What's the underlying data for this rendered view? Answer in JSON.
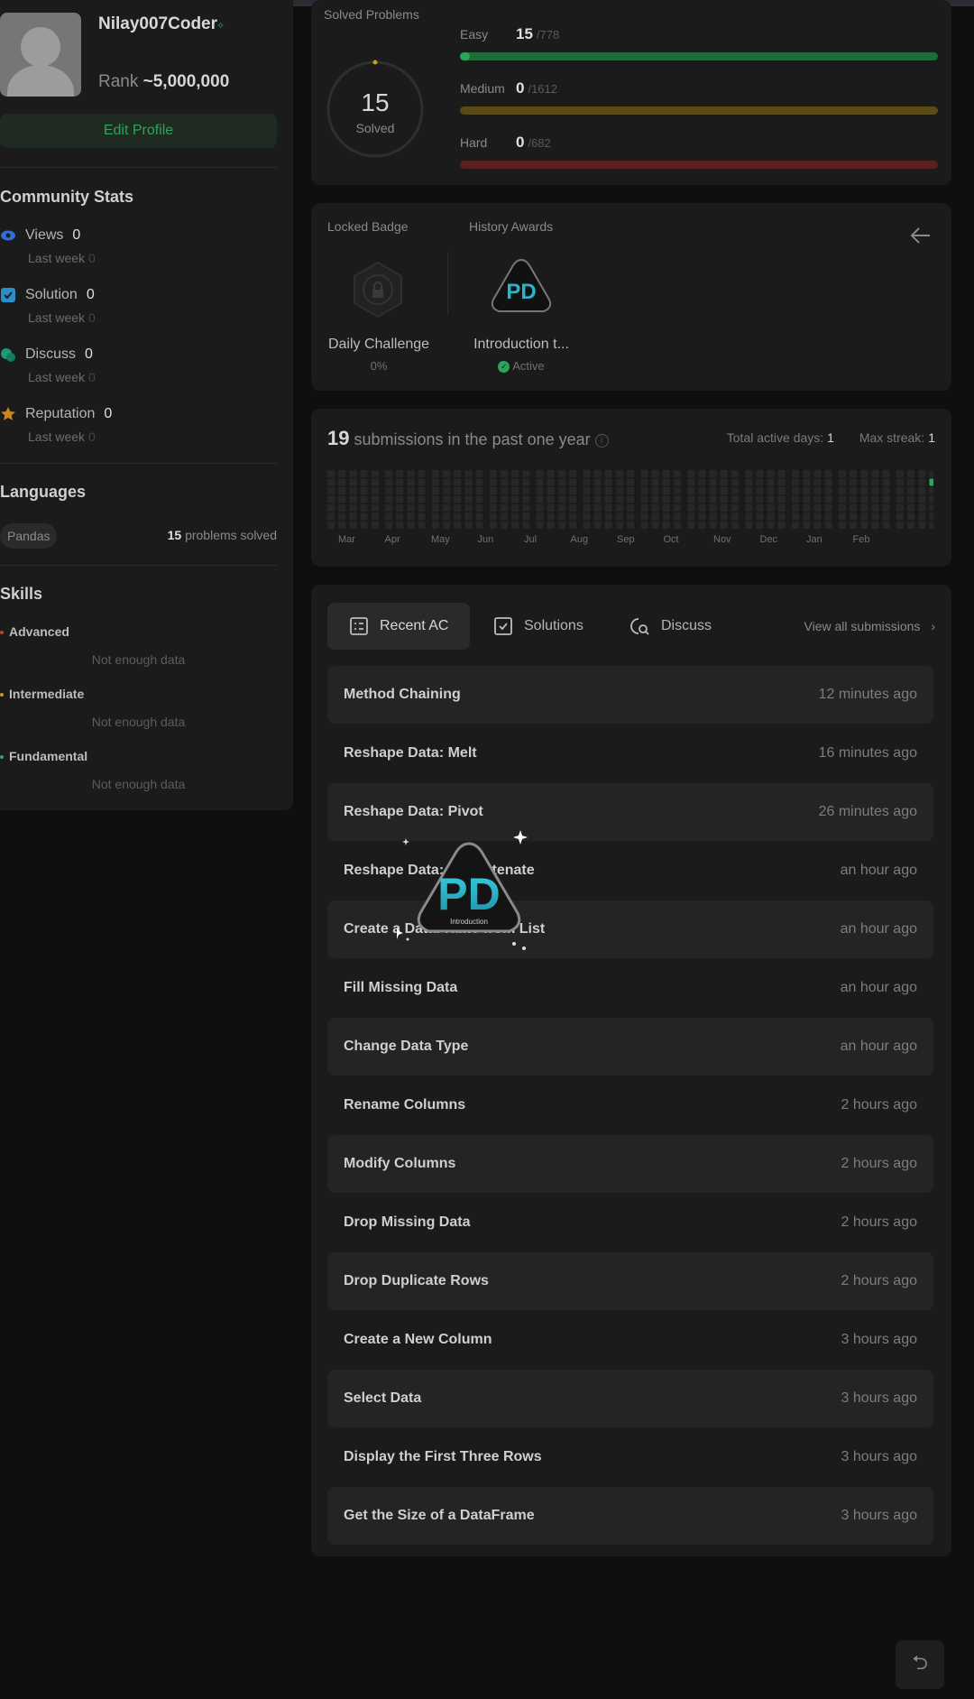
{
  "profile": {
    "username": "Nilay007Coder",
    "rank_label": "Rank",
    "rank_value": "~5,000,000",
    "edit_button": "Edit Profile"
  },
  "community": {
    "title": "Community Stats",
    "last_week_label": "Last week",
    "items": [
      {
        "label": "Views",
        "value": "0",
        "last_week": "0",
        "icon": "eye-icon",
        "color": "#2f6fd6"
      },
      {
        "label": "Solution",
        "value": "0",
        "last_week": "0",
        "icon": "solution-check-icon",
        "color": "#2a8fc8"
      },
      {
        "label": "Discuss",
        "value": "0",
        "last_week": "0",
        "icon": "discuss-icon",
        "color": "#1f9a74"
      },
      {
        "label": "Reputation",
        "value": "0",
        "last_week": "0",
        "icon": "star-icon",
        "color": "#c8861e"
      }
    ]
  },
  "languages": {
    "title": "Languages",
    "tag": "Pandas",
    "solved_count": "15",
    "solved_suffix": "problems solved"
  },
  "skills": {
    "title": "Skills",
    "items": [
      {
        "label": "Advanced",
        "color": "#b8432f",
        "empty": "Not enough data"
      },
      {
        "label": "Intermediate",
        "color": "#c89a1e",
        "empty": "Not enough data"
      },
      {
        "label": "Fundamental",
        "color": "#2ca55a",
        "empty": "Not enough data"
      }
    ]
  },
  "solved": {
    "title": "Solved Problems",
    "total": "15",
    "total_label": "Solved",
    "difficulties": [
      {
        "label": "Easy",
        "solved": "15",
        "total": "/778",
        "fraction": 0.019,
        "color": "#1f6b3a",
        "fill": "#2ca55a"
      },
      {
        "label": "Medium",
        "solved": "0",
        "total": "/1612",
        "fraction": 0,
        "color": "#5a4b16",
        "fill": "#c89a1e"
      },
      {
        "label": "Hard",
        "solved": "0",
        "total": "/682",
        "fraction": 0,
        "color": "#5a1f1f",
        "fill": "#c8433a"
      }
    ]
  },
  "badges": {
    "locked_label": "Locked Badge",
    "history_label": "History Awards",
    "locked_name": "Daily Challenge",
    "locked_progress": "0%",
    "award_name": "Introduction t...",
    "award_status": "Active",
    "badge_text": "PD",
    "badge_subtext": "Introduction"
  },
  "submissions": {
    "count": "19",
    "count_text": "submissions in the past one year",
    "active_days_label": "Total active days:",
    "active_days": "1",
    "max_streak_label": "Max streak:",
    "max_streak": "1",
    "months": [
      "Mar",
      "Apr",
      "May",
      "Jun",
      "Jul",
      "Aug",
      "Sep",
      "Oct",
      "Nov",
      "Dec",
      "Jan",
      "Feb"
    ]
  },
  "recent": {
    "tabs": [
      {
        "label": "Recent AC",
        "icon": "recent-ac-icon"
      },
      {
        "label": "Solutions",
        "icon": "solutions-icon"
      },
      {
        "label": "Discuss",
        "icon": "discuss-search-icon"
      }
    ],
    "view_all": "View all submissions",
    "items": [
      {
        "title": "Method Chaining",
        "time": "12 minutes ago"
      },
      {
        "title": "Reshape Data: Melt",
        "time": "16 minutes ago"
      },
      {
        "title": "Reshape Data: Pivot",
        "time": "26 minutes ago"
      },
      {
        "title": "Reshape Data: Concatenate",
        "time": "an hour ago"
      },
      {
        "title": "Create a DataFrame from List",
        "time": "an hour ago"
      },
      {
        "title": "Fill Missing Data",
        "time": "an hour ago"
      },
      {
        "title": "Change Data Type",
        "time": "an hour ago"
      },
      {
        "title": "Rename Columns",
        "time": "2 hours ago"
      },
      {
        "title": "Modify Columns",
        "time": "2 hours ago"
      },
      {
        "title": "Drop Missing Data",
        "time": "2 hours ago"
      },
      {
        "title": "Drop Duplicate Rows",
        "time": "2 hours ago"
      },
      {
        "title": "Create a New Column",
        "time": "3 hours ago"
      },
      {
        "title": "Select Data",
        "time": "3 hours ago"
      },
      {
        "title": "Display the First Three Rows",
        "time": "3 hours ago"
      },
      {
        "title": "Get the Size of a DataFrame",
        "time": "3 hours ago"
      }
    ]
  },
  "float_button_icon": "refresh-icon"
}
